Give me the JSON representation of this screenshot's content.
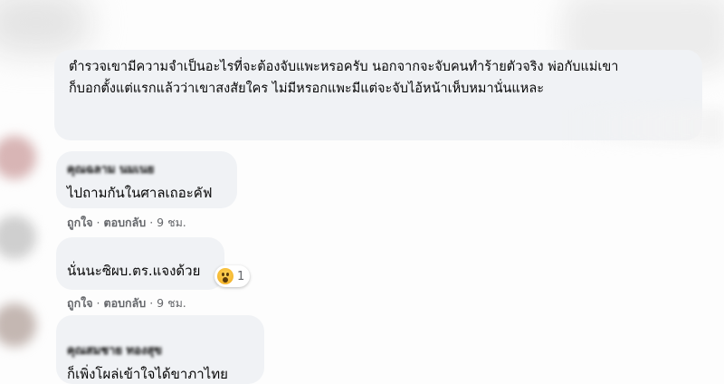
{
  "post": {
    "text_line1": "ตำรวจเขามีความจำเป็นอะไรที่จะต้องจับแพะหรอครับ นอกจากจะจับคนทำร้ายตัวจริง พ่อกับแม่เขา",
    "text_line2": "ก็บอกตั้งแต่แรกแล้วว่าเขาสงสัยใคร ไม่มีหรอกแพะมีแต่จะจับไอ้หน้าเห็บหมานั่นแหละ"
  },
  "comments": [
    {
      "author": "คุณฉลาม นมเนย",
      "text": "ไปถามกันในศาลเถอะคัฟ",
      "meta": {
        "like": "ถูกใจ",
        "separator": " · ",
        "reply": "ตอบกลับ",
        "time": " · 9 ชม."
      }
    },
    {
      "author": "",
      "text": "นั่นนะซิผบ.ตร.แจงด้วย",
      "reaction": {
        "icon": "wow-reaction-icon",
        "count": "1"
      },
      "meta": {
        "like": "ถูกใจ",
        "separator": " · ",
        "reply": "ตอบกลับ",
        "time": " · 9 ชม."
      }
    },
    {
      "author": "คุณสมชาย ทองสุข",
      "text": "ก็เพิ่งโผล่เข้าใจได้ขาภาไทย"
    }
  ],
  "colors": {
    "bubble": "#f0f2f5",
    "meta": "#65676b",
    "text": "#050505"
  }
}
